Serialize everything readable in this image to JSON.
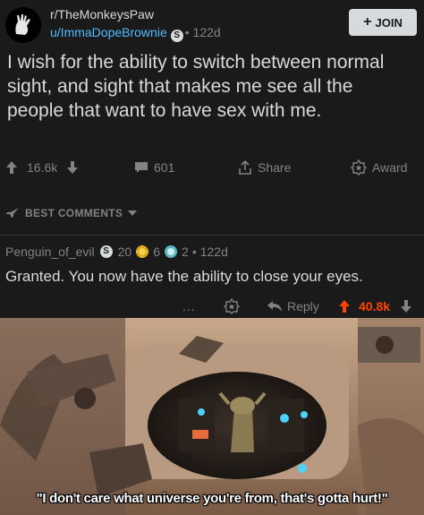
{
  "post": {
    "subreddit": "r/TheMonkeysPaw",
    "user": "u/ImmaDopeBrownie",
    "user_badge": "S",
    "time": "122d",
    "join_label": "JOIN",
    "title": "I wish for the ability to switch between normal sight, and sight that makes me see all the people that want to have sex with me.",
    "upvotes": "16.6k",
    "comments": "601",
    "share_label": "Share",
    "award_label": "Award"
  },
  "sort": {
    "label": "BEST COMMENTS"
  },
  "comment": {
    "author": "Penguin_of_evil",
    "award1_count": "20",
    "award2_count": "6",
    "award3_count": "2",
    "time": "122d",
    "body": "Granted. You now have the ability to close your eyes.",
    "more_label": "...",
    "reply_label": "Reply",
    "score": "40.8k"
  },
  "meme": {
    "caption": "\"I don't care what universe you're from, that's gotta hurt!\""
  },
  "colors": {
    "background": "#1a1a1b",
    "text": "#d7dadc",
    "muted": "#818384",
    "link": "#4fbcff",
    "upvote": "#ff4500"
  }
}
